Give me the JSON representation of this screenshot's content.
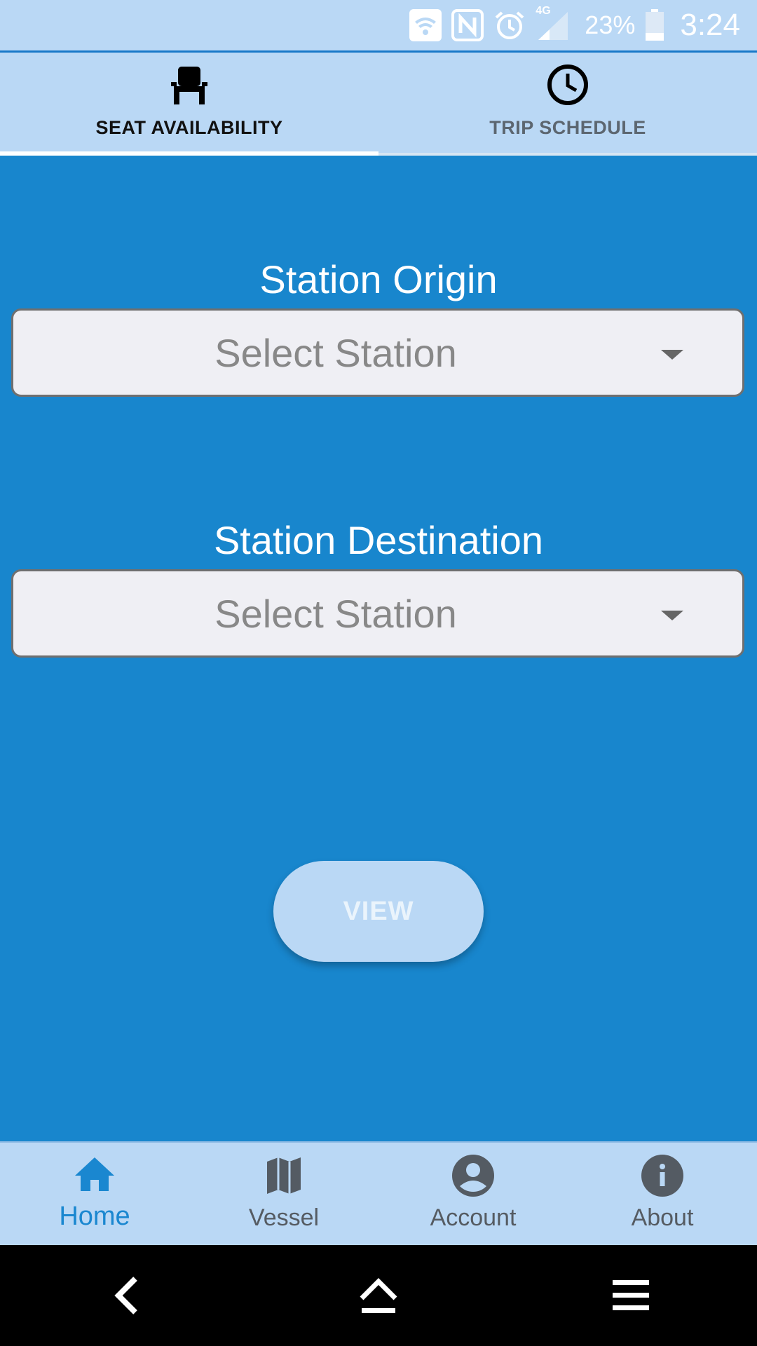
{
  "status_bar": {
    "battery_percent": "23%",
    "time": "3:24",
    "network": "4G",
    "icons": [
      "wifi-icon",
      "nfc-icon",
      "alarm-icon",
      "signal-icon",
      "battery-icon"
    ]
  },
  "tabs": [
    {
      "label": "SEAT AVAILABILITY",
      "icon": "seat-icon",
      "active": true
    },
    {
      "label": "TRIP SCHEDULE",
      "icon": "clock-icon",
      "active": false
    }
  ],
  "form": {
    "origin_label": "Station Origin",
    "origin_value": "Select Station",
    "destination_label": "Station Destination",
    "destination_value": "Select Station",
    "view_button": "VIEW"
  },
  "bottom_nav": [
    {
      "label": "Home",
      "icon": "home-icon",
      "active": true
    },
    {
      "label": "Vessel",
      "icon": "map-icon",
      "active": false
    },
    {
      "label": "Account",
      "icon": "account-icon",
      "active": false
    },
    {
      "label": "About",
      "icon": "info-icon",
      "active": false
    }
  ],
  "colors": {
    "background": "#1886cd",
    "bar": "#bad8f5",
    "accent": "#1a87d0",
    "field": "#efeff4"
  }
}
